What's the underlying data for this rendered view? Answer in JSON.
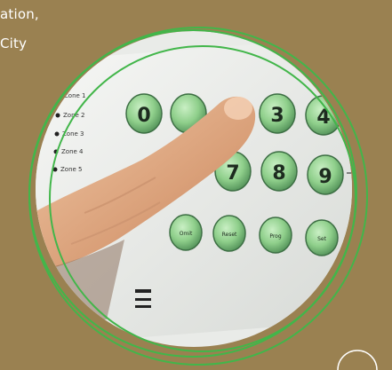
{
  "caption": {
    "line1": "ation,",
    "line2": "City"
  },
  "keypad": {
    "zones": [
      "Zone 1",
      "Zone 2",
      "Zone 3",
      "Zone 4",
      "Zone 5"
    ],
    "digits": [
      "0",
      "3",
      "4",
      "7",
      "8",
      "9"
    ],
    "function_keys": [
      "Omit",
      "Reset",
      "Prog",
      "Set"
    ]
  },
  "colors": {
    "background": "#9a8151",
    "ring_stroke": "#42b64a",
    "key_green": "#8fcf8b",
    "panel_white": "#eef0ee"
  }
}
